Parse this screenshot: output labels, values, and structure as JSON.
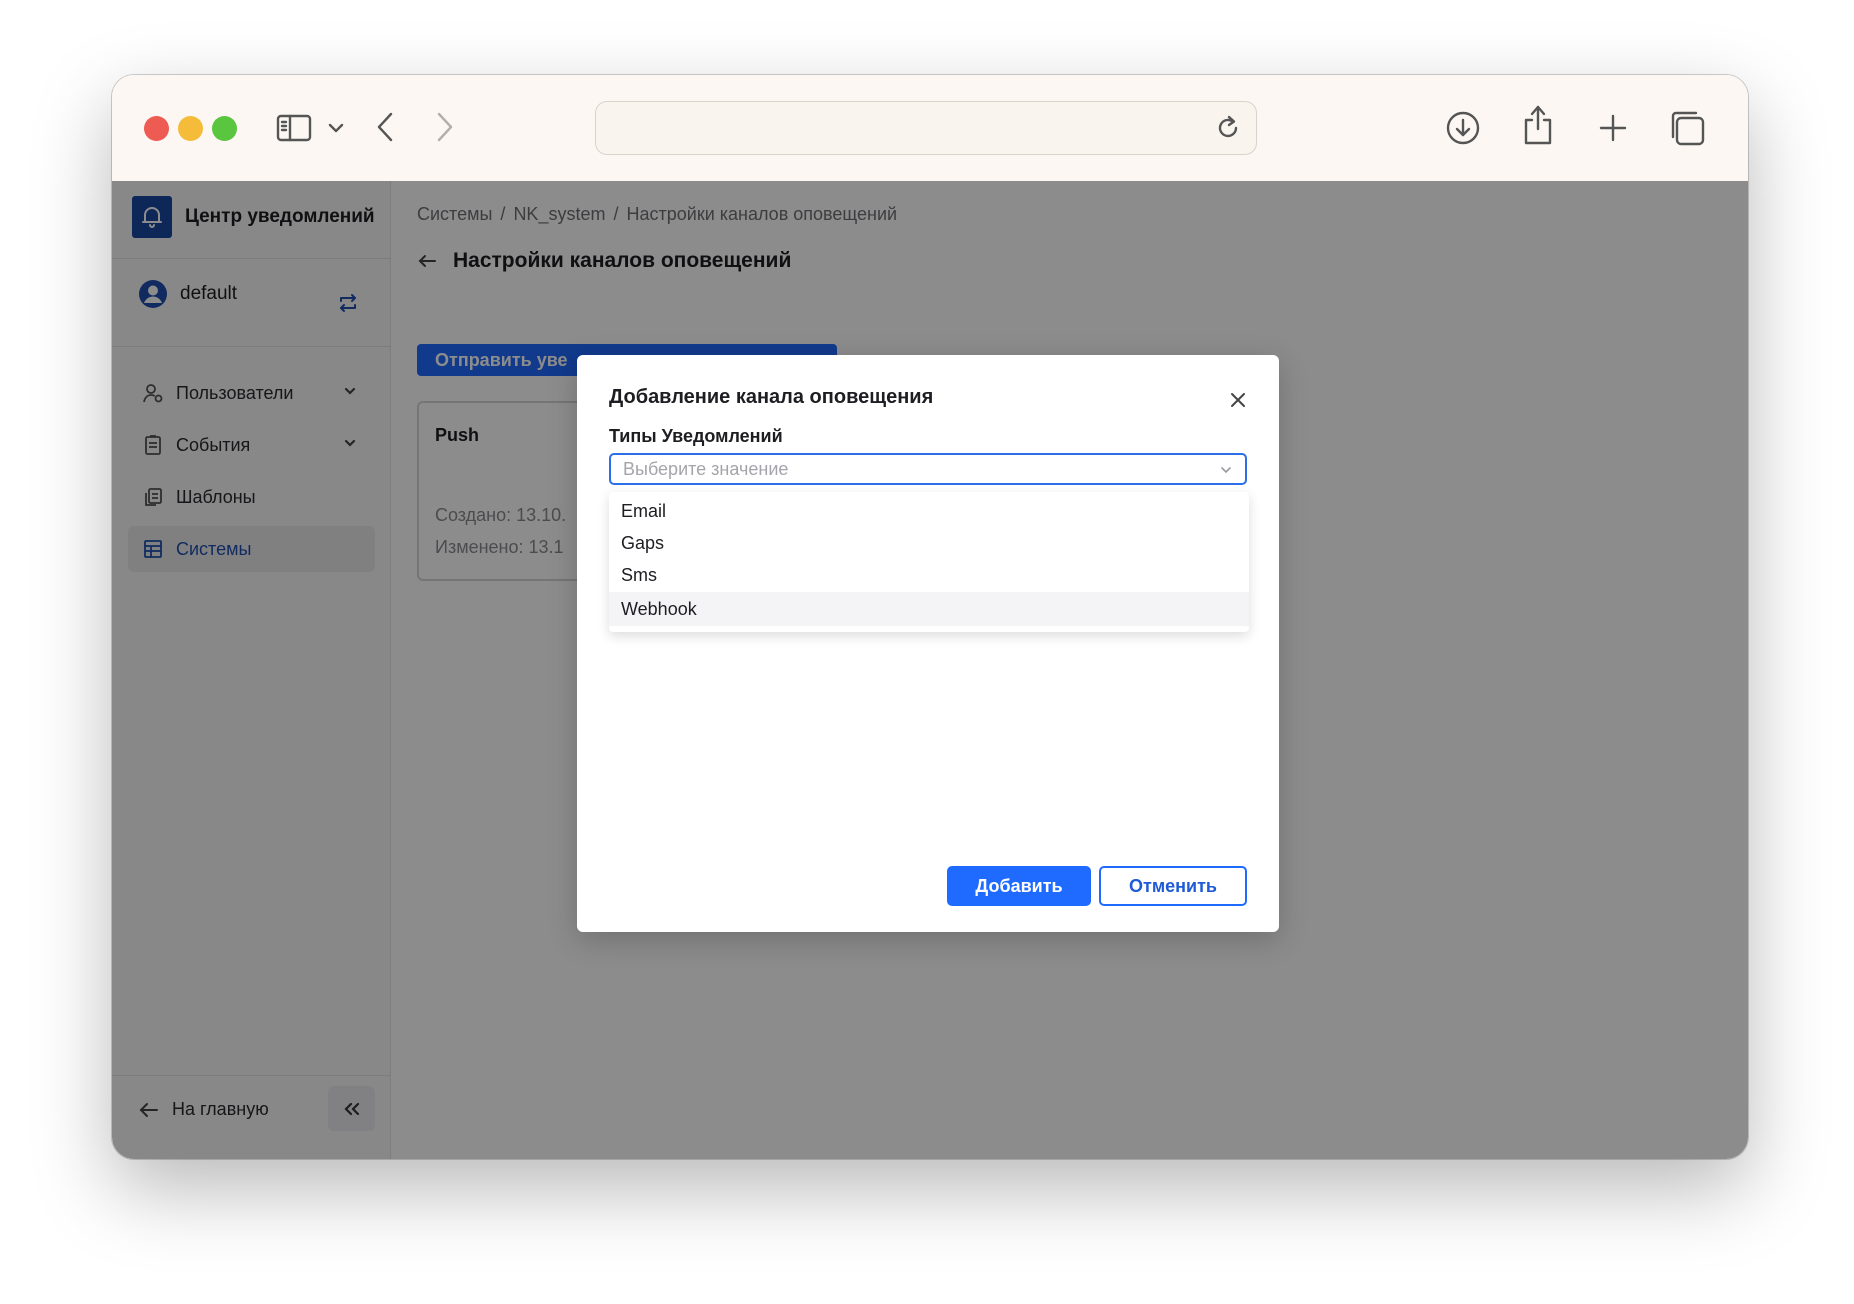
{
  "browser": {
    "url": "",
    "icons": [
      "sidebar-toggle-icon",
      "chevron-down-icon",
      "back-icon",
      "forward-icon",
      "reload-icon",
      "download-icon",
      "share-icon",
      "new-tab-icon",
      "tabs-overview-icon"
    ]
  },
  "colors": {
    "primary": "#1f6bff",
    "brand": "#1a47a3",
    "active_nav": "#1f4fb0",
    "traffic_red": "#ee5b52",
    "traffic_yellow": "#f5bc3a",
    "traffic_green": "#5ac53f"
  },
  "sidebar": {
    "brand_title": "Центр уведомлений",
    "user_name": "default",
    "items": [
      {
        "label": "Пользователи",
        "icon": "user-settings-icon",
        "has_submenu": true
      },
      {
        "label": "События",
        "icon": "clipboard-icon",
        "has_submenu": true
      },
      {
        "label": "Шаблоны",
        "icon": "copy-icon",
        "has_submenu": false
      },
      {
        "label": "Системы",
        "icon": "table-icon",
        "has_submenu": false,
        "active": true
      }
    ],
    "back_label": "На главную"
  },
  "main": {
    "breadcrumbs": [
      "Системы",
      "NK_system",
      "Настройки каналов оповещений"
    ],
    "page_title": "Настройки каналов оповещений",
    "send_button_label": "Отправить уве",
    "card": {
      "title": "Push",
      "created": "Создано: 13.10.",
      "modified": "Изменено: 13.1"
    }
  },
  "modal": {
    "title": "Добавление канала оповещения",
    "field_label": "Типы Уведомлений",
    "select_placeholder": "Выберите значение",
    "options": [
      "Email",
      "Gaps",
      "Sms",
      "Webhook"
    ],
    "hovered_option": "Webhook",
    "add_label": "Добавить",
    "cancel_label": "Отменить"
  }
}
